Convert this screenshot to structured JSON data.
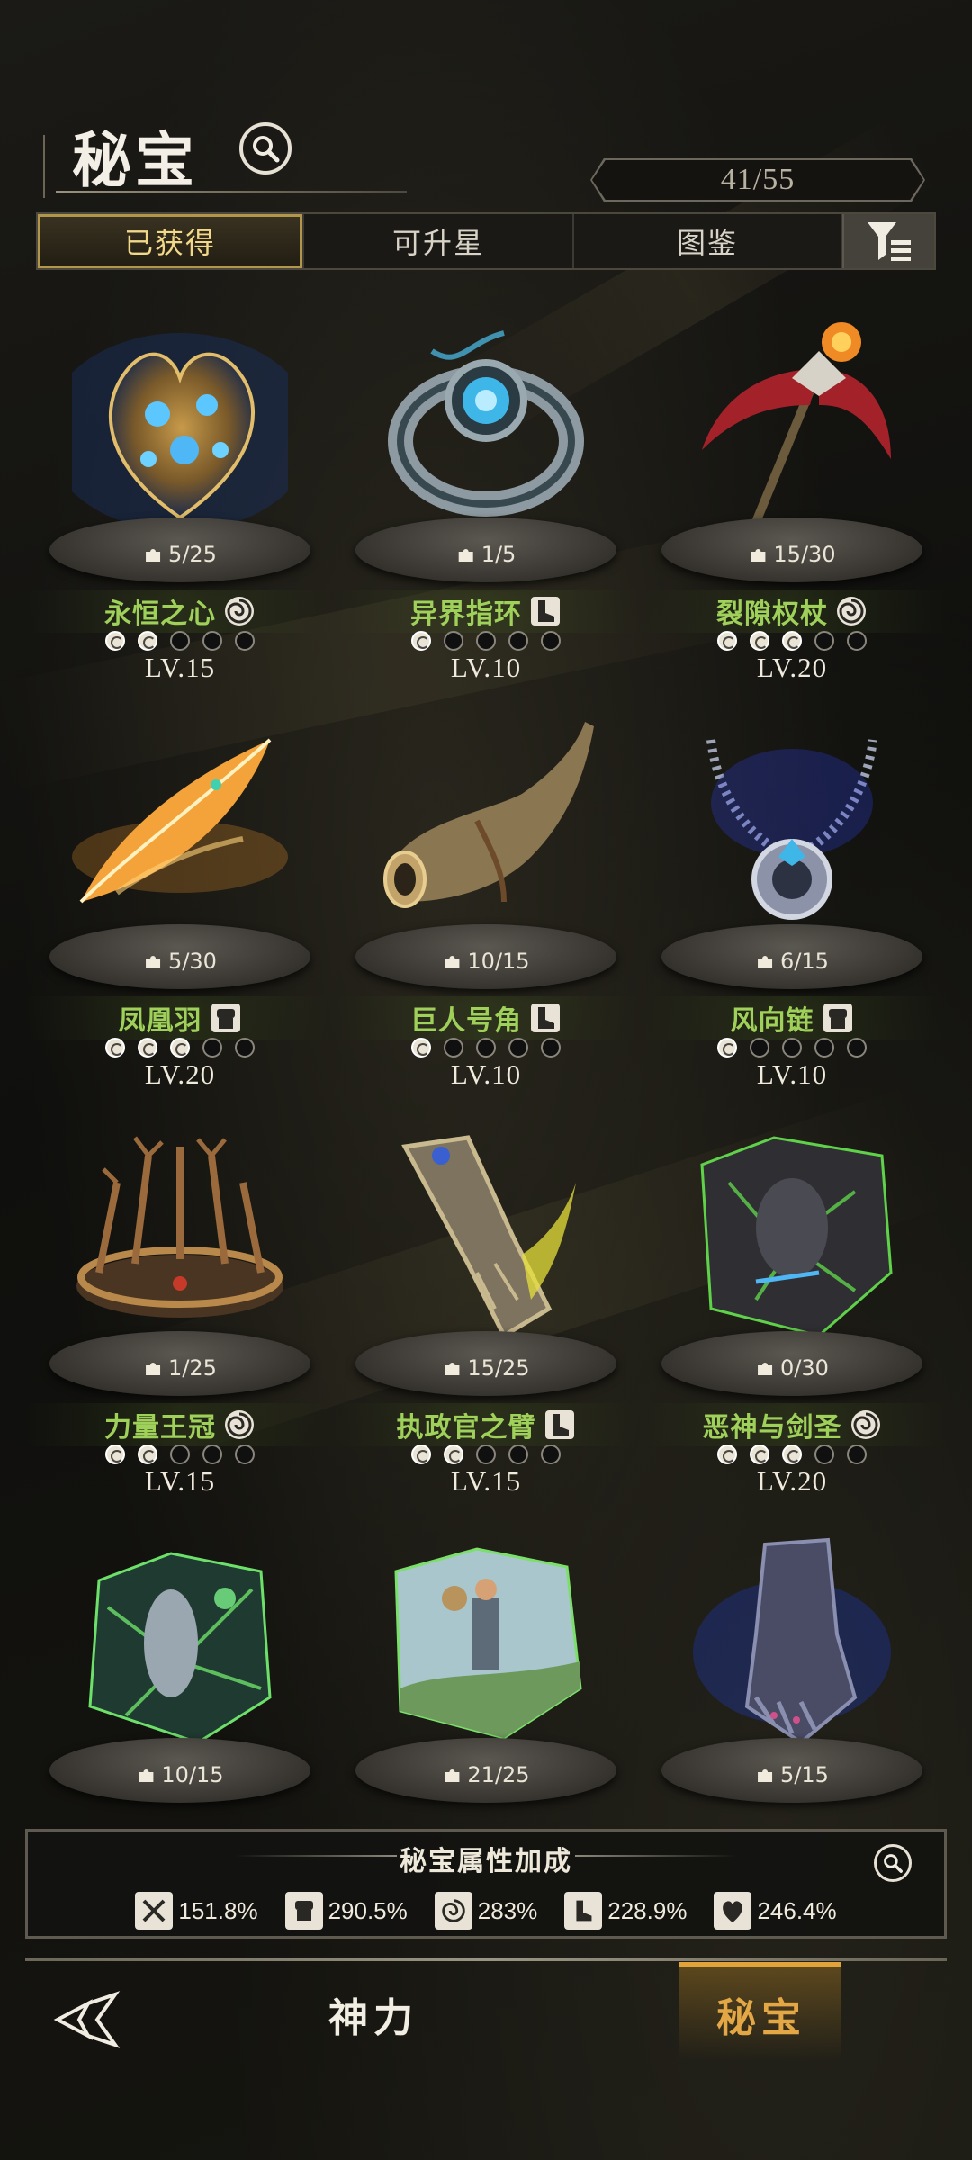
{
  "header": {
    "title": "秘宝",
    "counter": "41/55"
  },
  "tabs": [
    {
      "label": "已获得",
      "active": true
    },
    {
      "label": "可升星",
      "active": false
    },
    {
      "label": "图鉴",
      "active": false
    }
  ],
  "items": [
    {
      "name": "永恒之心",
      "shards": "5/25",
      "level": "LV.15",
      "stars": 2,
      "type_icon": "spiral-icon",
      "art": "heart-relic"
    },
    {
      "name": "异界指环",
      "shards": "1/5",
      "level": "LV.10",
      "stars": 1,
      "type_icon": "boot-icon",
      "art": "ring"
    },
    {
      "name": "裂隙权杖",
      "shards": "15/30",
      "level": "LV.20",
      "stars": 3,
      "type_icon": "spiral-icon",
      "art": "scepter"
    },
    {
      "name": "凤凰羽",
      "shards": "5/30",
      "level": "LV.20",
      "stars": 3,
      "type_icon": "fist-icon",
      "art": "feather"
    },
    {
      "name": "巨人号角",
      "shards": "10/15",
      "level": "LV.10",
      "stars": 1,
      "type_icon": "boot-icon",
      "art": "horn"
    },
    {
      "name": "风向链",
      "shards": "6/15",
      "level": "LV.10",
      "stars": 1,
      "type_icon": "fist-icon",
      "art": "necklace"
    },
    {
      "name": "力量王冠",
      "shards": "1/25",
      "level": "LV.15",
      "stars": 2,
      "type_icon": "spiral-icon",
      "art": "crown"
    },
    {
      "name": "执政官之臂",
      "shards": "15/25",
      "level": "LV.15",
      "stars": 2,
      "type_icon": "boot-icon",
      "art": "gauntlet"
    },
    {
      "name": "恶神与剑圣",
      "shards": "0/30",
      "level": "LV.20",
      "stars": 3,
      "type_icon": "spiral-icon",
      "art": "card-dark"
    },
    {
      "name": "",
      "shards": "10/15",
      "level": "",
      "stars": 0,
      "type_icon": "",
      "art": "card-green"
    },
    {
      "name": "",
      "shards": "21/25",
      "level": "",
      "stars": 0,
      "type_icon": "",
      "art": "card-traveler"
    },
    {
      "name": "",
      "shards": "5/15",
      "level": "",
      "stars": 0,
      "type_icon": "",
      "art": "gauntlet-blue"
    }
  ],
  "bonus": {
    "title": "秘宝属性加成",
    "stats": [
      {
        "icon": "sword-icon",
        "value": "151.8%"
      },
      {
        "icon": "fist-icon",
        "value": "290.5%"
      },
      {
        "icon": "spiral-icon",
        "value": "283%"
      },
      {
        "icon": "boot-icon",
        "value": "228.9%"
      },
      {
        "icon": "heart-icon",
        "value": "246.4%"
      }
    ]
  },
  "nav": {
    "power": "神力",
    "secret": "秘宝"
  },
  "colors": {
    "accent_gold": "#e4a745",
    "name_green": "#9fd15a",
    "tab_active_text": "#f2d98a"
  }
}
